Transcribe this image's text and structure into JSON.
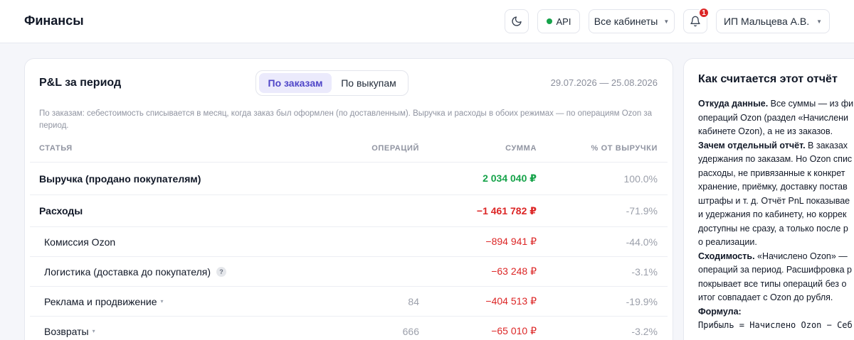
{
  "header": {
    "title": "Финансы",
    "api_label": "API",
    "cabinets_label": "Все кабинеты",
    "notifications_count": "1",
    "user_label": "ИП Мальцева А.В."
  },
  "pnl": {
    "title": "P&L за период",
    "mode_orders": "По заказам",
    "mode_buyouts": "По выкупам",
    "period": "29.07.2026 — 25.08.2026",
    "note": "По заказам: себестоимость списывается в месяц, когда заказ был оформлен (по доставленным). Выручка и расходы в обоих режимах — по операциям Ozon за период.",
    "columns": {
      "article": "СТАТЬЯ",
      "ops": "ОПЕРАЦИЙ",
      "sum": "СУММА",
      "pct": "% ОТ ВЫРУЧКИ"
    },
    "rows": [
      {
        "name": "Выручка (продано покупателям)",
        "ops": "",
        "sum": "2 034 040 ₽",
        "pct": "100.0%"
      },
      {
        "name": "Расходы",
        "ops": "",
        "sum": "−1 461 782 ₽",
        "pct": "-71.9%"
      },
      {
        "name": "Комиссия Ozon",
        "ops": "",
        "sum": "−894 941 ₽",
        "pct": "-44.0%"
      },
      {
        "name": "Логистика (доставка до покупателя)",
        "ops": "",
        "sum": "−63 248 ₽",
        "pct": "-3.1%"
      },
      {
        "name": "Реклама и продвижение",
        "ops": "84",
        "sum": "−404 513 ₽",
        "pct": "-19.9%"
      },
      {
        "name": "Возвраты",
        "ops": "666",
        "sum": "−65 010 ₽",
        "pct": "-3.2%"
      }
    ]
  },
  "explain": {
    "title": "Как считается этот отчёт",
    "p1_bold": "Откуда данные.",
    "p1_l1": " Все суммы — из фи",
    "p1_l2": "операций Ozon (раздел «Начислени",
    "p1_l3": "кабинете Ozon), а не из заказов.",
    "p2_bold": "Зачем отдельный отчёт.",
    "p2_l1": " В заказах",
    "p2_l2": "удержания по заказам. Но Ozon спис",
    "p2_l3": "расходы, не привязанные к конкрет",
    "p2_l4": "хранение, приёмку, доставку постав",
    "p2_l5": "штрафы и т. д. Отчёт PnL показывае",
    "p2_l6": "и удержания по кабинету, но коррек",
    "p2_l7": "доступны не сразу, а только после р",
    "p2_l8": "о реализации.",
    "p3_bold": "Сходимость.",
    "p3_l1": " «Начислено Ozon» —",
    "p3_l2": "операций за период. Расшифровка р",
    "p3_l3": "покрывает все типы операций без о",
    "p3_l4": "итог совпадает с Ozon до рубля.",
    "p4_bold": "Формула:",
    "formula": "Прибыль = Начислено Ozon − Себ"
  }
}
